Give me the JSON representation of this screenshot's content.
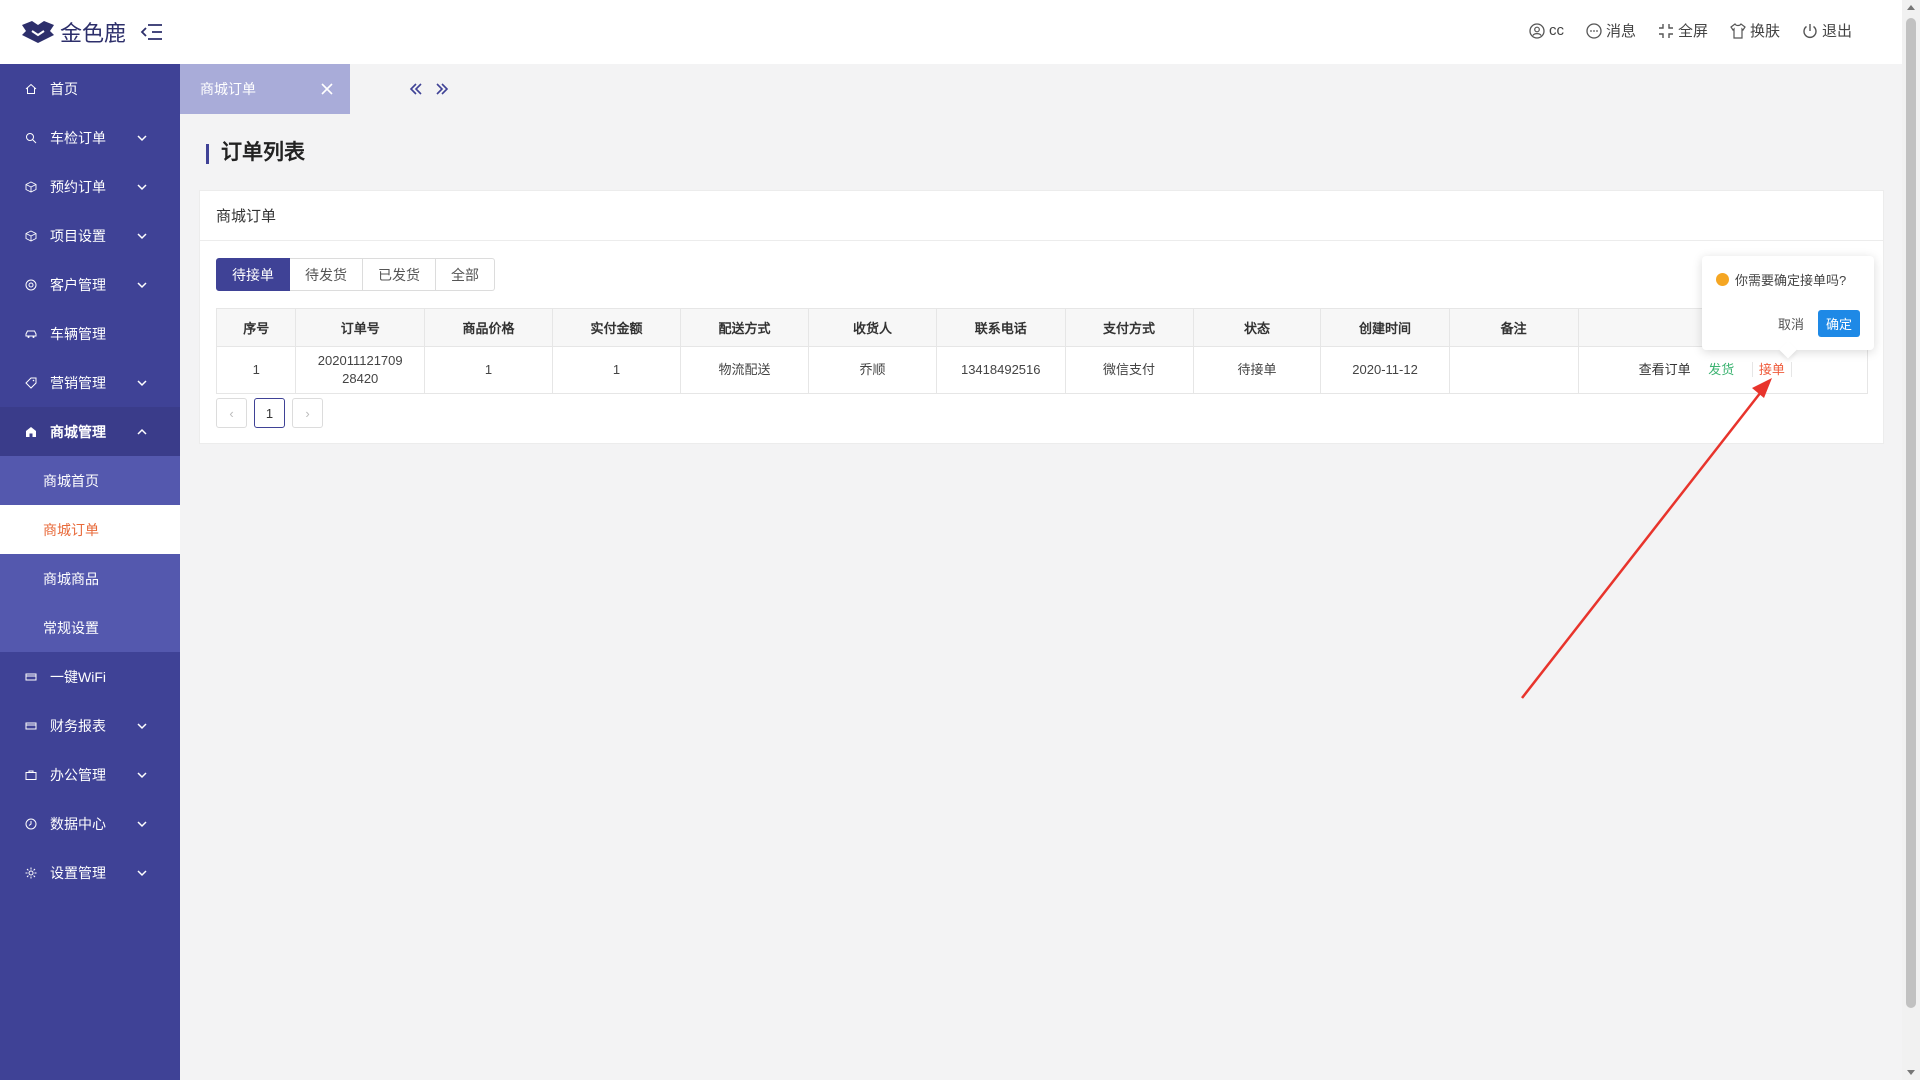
{
  "header": {
    "brand": "金色鹿",
    "user": "cc",
    "messages": "消息",
    "fullscreen": "全屏",
    "skin": "换肤",
    "logout": "退出"
  },
  "sidebar": {
    "items": [
      {
        "label": "首页",
        "icon": "home-icon"
      },
      {
        "label": "车检订单",
        "icon": "search-icon"
      },
      {
        "label": "预约订单",
        "icon": "cube-icon"
      },
      {
        "label": "项目设置",
        "icon": "cube-icon"
      },
      {
        "label": "客户管理",
        "icon": "target-icon"
      },
      {
        "label": "车辆管理",
        "icon": "car-icon"
      },
      {
        "label": "营销管理",
        "icon": "tag-icon"
      },
      {
        "label": "商城管理",
        "icon": "shop-icon"
      }
    ],
    "submenu": [
      "商城首页",
      "商城订单",
      "商城商品",
      "常规设置"
    ],
    "items_after": [
      {
        "label": "一键WiFi",
        "icon": "card-icon"
      },
      {
        "label": "财务报表",
        "icon": "card-icon"
      },
      {
        "label": "办公管理",
        "icon": "briefcase-icon"
      },
      {
        "label": "数据中心",
        "icon": "clock-icon"
      },
      {
        "label": "设置管理",
        "icon": "gear-icon"
      }
    ]
  },
  "tabs": {
    "active": "商城订单"
  },
  "page": {
    "title": "订单列表",
    "card_title": "商城订单"
  },
  "filters": [
    "待接单",
    "待发货",
    "已发货",
    "全部"
  ],
  "table": {
    "headers": [
      "序号",
      "订单号",
      "商品价格",
      "实付金额",
      "配送方式",
      "收货人",
      "联系电话",
      "支付方式",
      "状态",
      "创建时间",
      "备注",
      ""
    ],
    "rows": [
      {
        "index": "1",
        "order_no_1": "202011121709",
        "order_no_2": "28420",
        "price": "1",
        "paid": "1",
        "delivery": "物流配送",
        "receiver": "乔顺",
        "phone": "13418492516",
        "payment": "微信支付",
        "status": "待接单",
        "created": "2020-11-12",
        "remark": "",
        "action_view": "查看订单",
        "action_ship": "发货",
        "action_accept": "接单"
      }
    ]
  },
  "pager": {
    "prev": "‹",
    "current": "1",
    "next": "›"
  },
  "popconfirm": {
    "message": "你需要确定接单吗?",
    "cancel": "取消",
    "ok": "确定"
  },
  "colors": {
    "sidebar": "#3f4296",
    "accent_orange": "#e86a3a",
    "ok_blue": "#1e89e6",
    "annotation_red": "#e8342c"
  }
}
